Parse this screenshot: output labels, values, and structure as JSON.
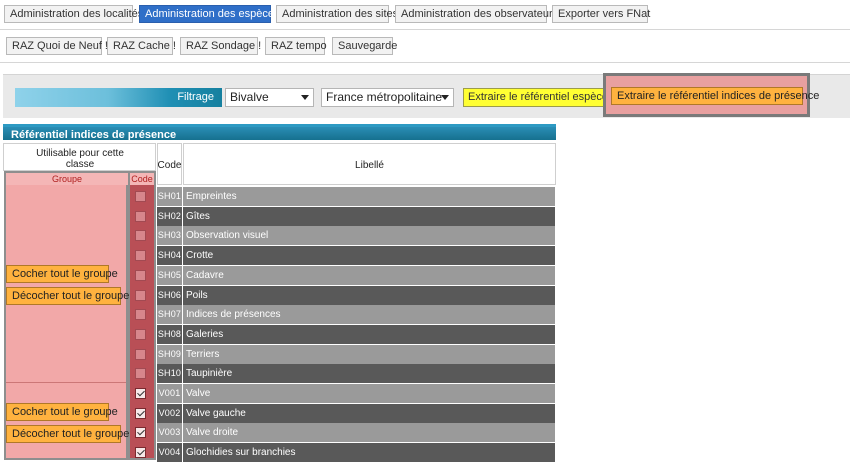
{
  "nav": {
    "row1": [
      {
        "label": "Administration des localités",
        "active": false
      },
      {
        "label": "Administration des espèces",
        "active": true
      },
      {
        "label": "Administration des sites",
        "active": false
      },
      {
        "label": "Administration des observateurs",
        "active": false
      },
      {
        "label": "Exporter vers FNat",
        "active": false
      }
    ],
    "row2": [
      {
        "label": "RAZ Quoi de Neuf !"
      },
      {
        "label": "RAZ Cache !"
      },
      {
        "label": "RAZ Sondage !"
      },
      {
        "label": "RAZ tempo"
      },
      {
        "label": "Sauvegarde"
      }
    ]
  },
  "filter": {
    "label": "Filtrage",
    "class_select": "Bivalve",
    "region_select": "France métropolitaine",
    "extract_species": "Extraire le référentiel espèces",
    "extract_indices": "Extraire le référentiel indices de présence"
  },
  "panel": {
    "title": "Référentiel indices de présence",
    "header_usable": "Utilisable pour cette classe",
    "header_group": "Groupe",
    "header_code_small": "Code",
    "header_code": "Code",
    "header_label": "Libellé"
  },
  "group_buttons": {
    "check_all": "Cocher tout le groupe",
    "uncheck_all": "Décocher tout le groupe"
  },
  "colors": {
    "active_tab": "#2f6fc8",
    "panel_header": "#16718f",
    "group_bg": "#f2a8a8",
    "code_col_bg": "#b94f56",
    "row_light": "#9a9a9a",
    "row_dark": "#595959",
    "highlight_yellow": "#ffff33",
    "highlight_orange": "#ffb23f"
  },
  "rows": [
    {
      "code": "SH01",
      "label": "Empreintes",
      "checked": false
    },
    {
      "code": "SH02",
      "label": "Gîtes",
      "checked": false
    },
    {
      "code": "SH03",
      "label": "Observation visuel",
      "checked": false
    },
    {
      "code": "SH04",
      "label": "Crotte",
      "checked": false
    },
    {
      "code": "SH05",
      "label": "Cadavre",
      "checked": false
    },
    {
      "code": "SH06",
      "label": "Poils",
      "checked": false
    },
    {
      "code": "SH07",
      "label": "Indices de présences",
      "checked": false
    },
    {
      "code": "SH08",
      "label": "Galeries",
      "checked": false
    },
    {
      "code": "SH09",
      "label": "Terriers",
      "checked": false
    },
    {
      "code": "SH10",
      "label": "Taupinière",
      "checked": false
    },
    {
      "code": "V001",
      "label": "Valve",
      "checked": true
    },
    {
      "code": "V002",
      "label": "Valve gauche",
      "checked": true
    },
    {
      "code": "V003",
      "label": "Valve droite",
      "checked": true
    },
    {
      "code": "V004",
      "label": "Glochidies sur branchies",
      "checked": true
    }
  ]
}
